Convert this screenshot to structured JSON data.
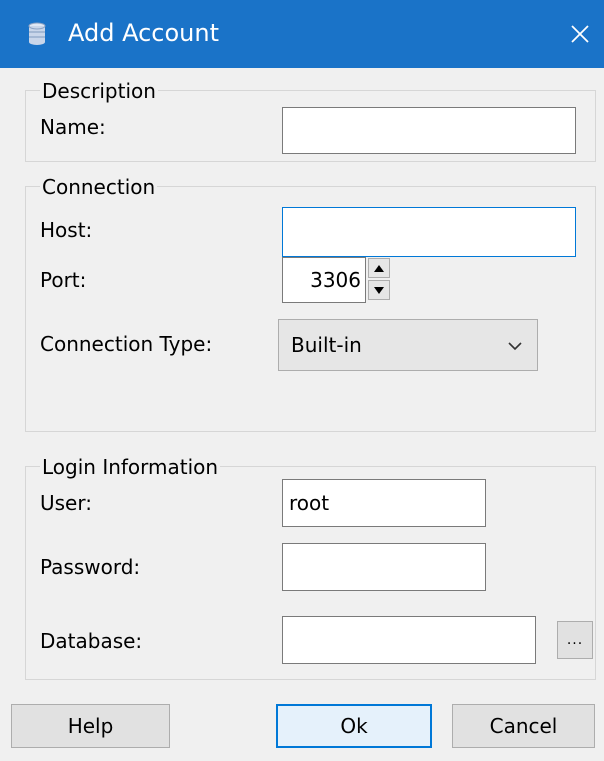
{
  "window": {
    "title": "Add Account",
    "icon": "database-icon",
    "close_icon": "close-icon",
    "titlebar_color": "#1a73c8"
  },
  "description": {
    "legend": "Description",
    "name_label": "Name:",
    "name_value": ""
  },
  "connection": {
    "legend": "Connection",
    "host_label": "Host:",
    "host_value": "",
    "port_label": "Port:",
    "port_value": "3306",
    "type_label": "Connection Type:",
    "type_value": "Built-in"
  },
  "login": {
    "legend": "Login Information",
    "user_label": "User:",
    "user_value": "root",
    "password_label": "Password:",
    "password_value": "",
    "database_label": "Database:",
    "database_value": "",
    "browse_label": "..."
  },
  "buttons": {
    "help": "Help",
    "ok": "Ok",
    "cancel": "Cancel"
  },
  "colors": {
    "accent": "#0078d7",
    "background": "#f0f0f0"
  }
}
